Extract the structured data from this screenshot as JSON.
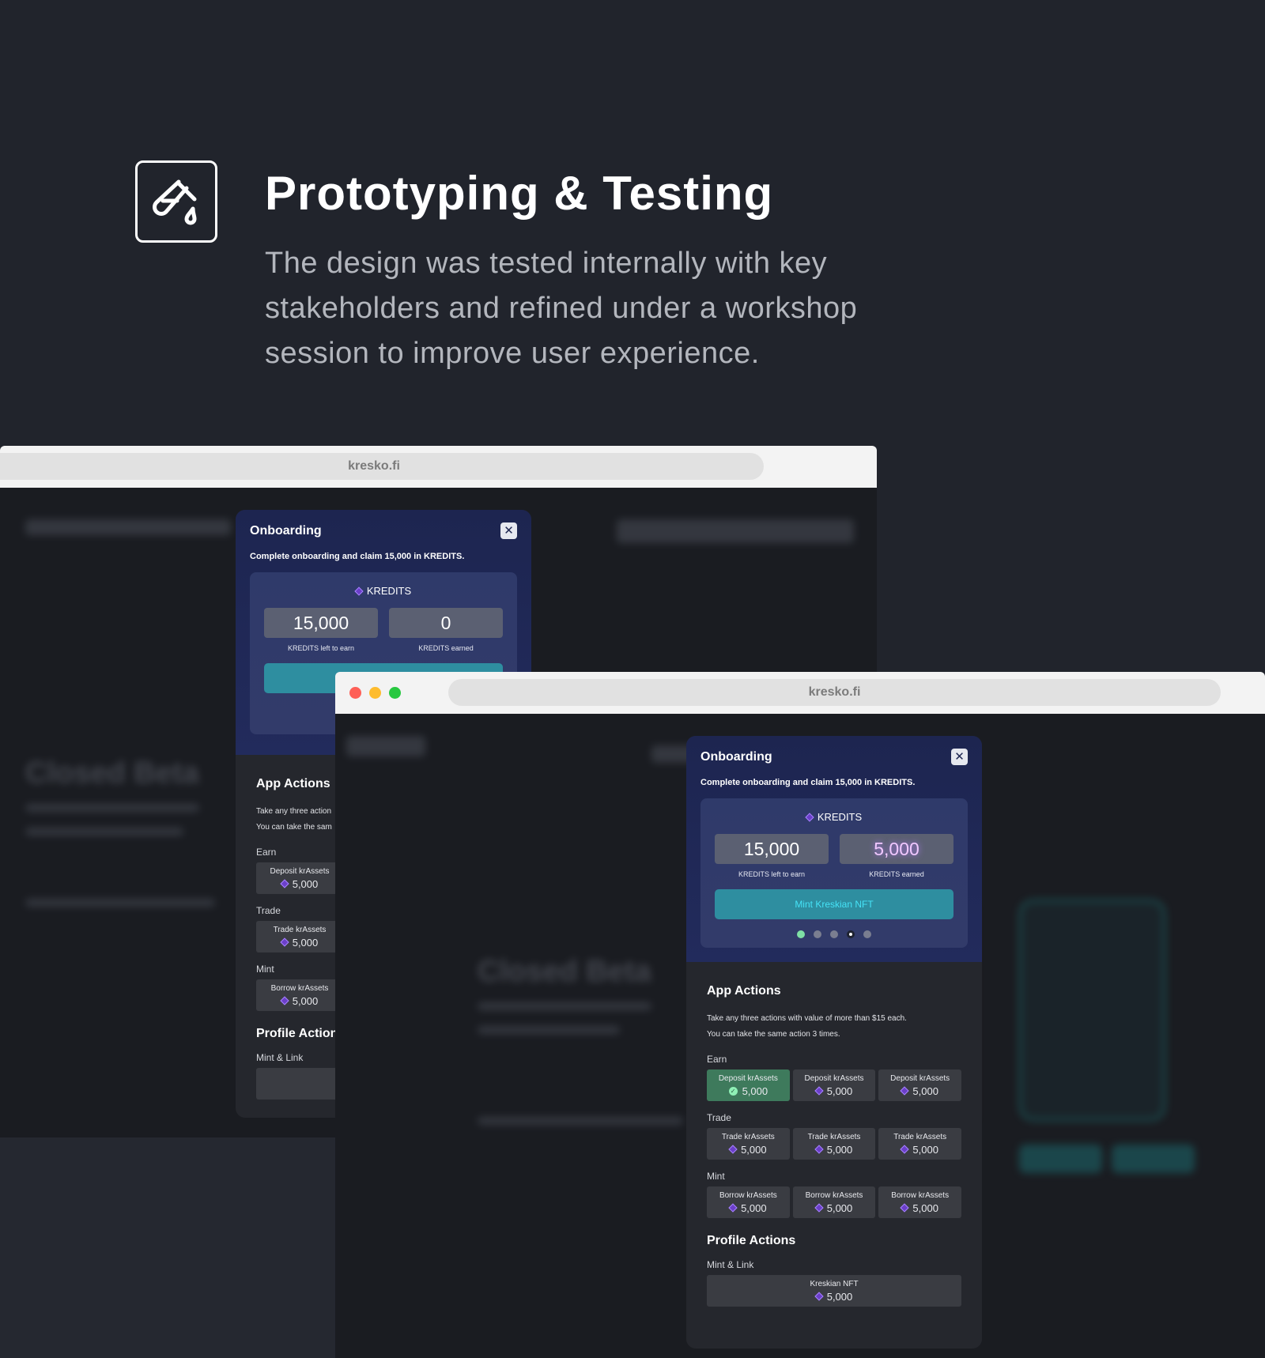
{
  "header": {
    "icon": "test-tube-icon",
    "title": "Prototyping & Testing",
    "description": "The design was tested internally with key stakeholders and refined under a workshop session to improve user experience."
  },
  "colors": {
    "background": "#21242c",
    "panel_gradient_top": "#1d2550",
    "mint_button": "#2e8ea0",
    "mint_text": "#45e3f7",
    "accent_purple": "#a884ff",
    "done_green": "#3e7a5c"
  },
  "back_browser": {
    "url": "kresko.fi",
    "onboarding": {
      "title": "Onboarding",
      "subtitle": "Complete onboarding and claim 15,000 in KREDITS.",
      "kredits_label": "KREDITS",
      "left_value": "15,000",
      "left_label": "KREDITS left to earn",
      "earned_value": "0",
      "earned_label": "KREDITS earned",
      "app_actions_title": "App Actions",
      "app_actions_desc_1": "Take any three action",
      "app_actions_desc_2": "You can take the sam",
      "groups": [
        {
          "label": "Earn",
          "action": "Deposit krAssets",
          "amount": "5,000"
        },
        {
          "label": "Trade",
          "action": "Trade krAssets",
          "amount": "5,000"
        },
        {
          "label": "Mint",
          "action": "Borrow krAssets",
          "amount": "5,000"
        }
      ],
      "profile_title": "Profile Action",
      "mint_link_label": "Mint & Link"
    }
  },
  "front_browser": {
    "url": "kresko.fi",
    "onboarding": {
      "title": "Onboarding",
      "subtitle": "Complete onboarding and claim 15,000 in KREDITS.",
      "kredits_label": "KREDITS",
      "left_value": "15,000",
      "left_label": "KREDITS left to earn",
      "earned_value": "5,000",
      "earned_label": "KREDITS earned",
      "mint_button": "Mint Kreskian NFT",
      "steps_total": 5,
      "steps_done": 1,
      "current_step": 4,
      "app_actions_title": "App Actions",
      "app_actions_desc_1": "Take any three actions with value of more than $15 each.",
      "app_actions_desc_2": "You can take the same action 3 times.",
      "groups": [
        {
          "label": "Earn",
          "actions": [
            {
              "label": "Deposit krAssets",
              "amount": "5,000",
              "completed": true
            },
            {
              "label": "Deposit krAssets",
              "amount": "5,000",
              "completed": false
            },
            {
              "label": "Deposit krAssets",
              "amount": "5,000",
              "completed": false
            }
          ]
        },
        {
          "label": "Trade",
          "actions": [
            {
              "label": "Trade krAssets",
              "amount": "5,000",
              "completed": false
            },
            {
              "label": "Trade krAssets",
              "amount": "5,000",
              "completed": false
            },
            {
              "label": "Trade krAssets",
              "amount": "5,000",
              "completed": false
            }
          ]
        },
        {
          "label": "Mint",
          "actions": [
            {
              "label": "Borrow krAssets",
              "amount": "5,000",
              "completed": false
            },
            {
              "label": "Borrow krAssets",
              "amount": "5,000",
              "completed": false
            },
            {
              "label": "Borrow krAssets",
              "amount": "5,000",
              "completed": false
            }
          ]
        }
      ],
      "profile_title": "Profile Actions",
      "mint_link_label": "Mint & Link",
      "nft_action": {
        "label": "Kreskian NFT",
        "amount": "5,000"
      }
    }
  },
  "background_page": {
    "heading": "Closed Beta"
  }
}
